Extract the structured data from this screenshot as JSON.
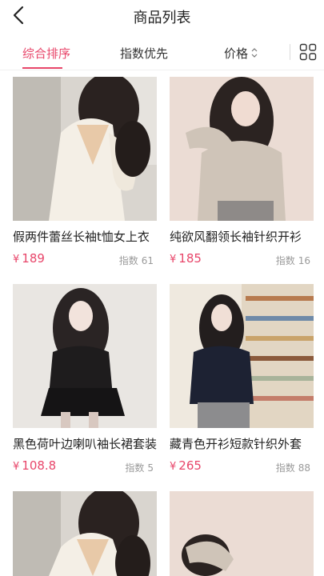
{
  "header": {
    "title": "商品列表"
  },
  "sort_tabs": {
    "composite": "综合排序",
    "index_first": "指数优先",
    "price": "价格"
  },
  "products": [
    {
      "title": "假两件蕾丝长袖t恤女上衣",
      "currency": "¥",
      "price": "189",
      "index_label": "指数",
      "index_value": "61"
    },
    {
      "title": "纯欲风翻领长袖针织开衫",
      "currency": "¥",
      "price": "185",
      "index_label": "指数",
      "index_value": "16"
    },
    {
      "title": "黑色荷叶边喇叭袖长裙套装",
      "currency": "¥",
      "price": "108.8",
      "index_label": "指数",
      "index_value": "5"
    },
    {
      "title": "藏青色开衫短款针织外套",
      "currency": "¥",
      "price": "265",
      "index_label": "指数",
      "index_value": "88"
    }
  ],
  "colors": {
    "accent": "#e8466a",
    "muted": "#9a9a9a"
  },
  "icons": [
    "chevron-left-icon",
    "chevron-updown-icon",
    "grid-toggle-icon"
  ]
}
